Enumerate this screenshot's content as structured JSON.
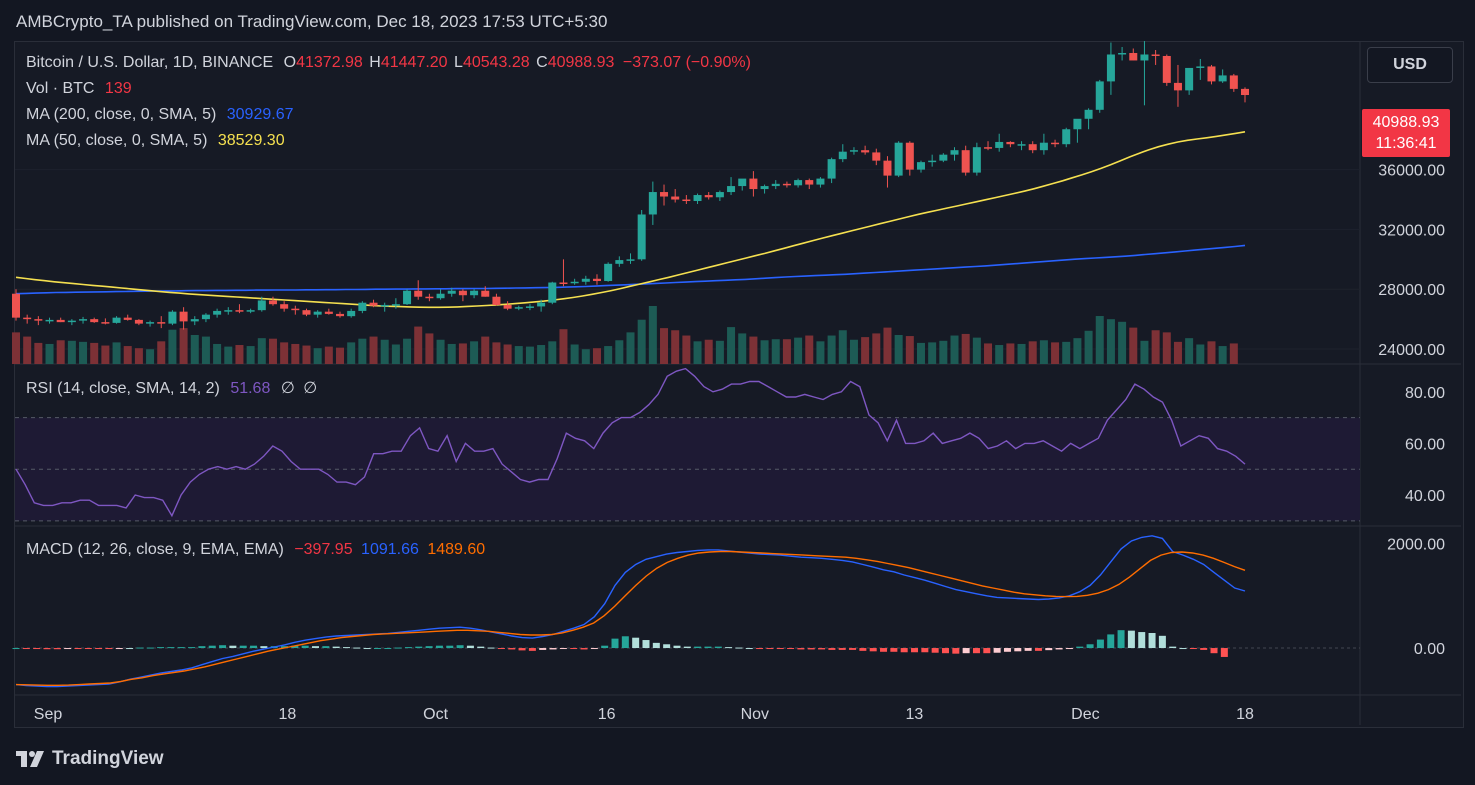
{
  "header": {
    "published_line": "AMBCrypto_TA published on TradingView.com, Dec 18, 2023 17:53 UTC+5:30"
  },
  "symbol": {
    "name": "Bitcoin / U.S. Dollar, 1D, BINANCE",
    "o_label": "O",
    "o_value": "41372.98",
    "h_label": "H",
    "h_value": "41447.20",
    "l_label": "L",
    "l_value": "40543.28",
    "c_label": "C",
    "c_value": "40988.93",
    "change": "−373.07 (−0.90%)"
  },
  "legend": {
    "vol_label": "Vol · BTC",
    "vol_value": "139",
    "ma200_label": "MA (200, close, 0, SMA, 5)",
    "ma200_value": "30929.67",
    "ma50_label": "MA (50, close, 0, SMA, 5)",
    "ma50_value": "38529.30",
    "rsi_label": "RSI (14, close, SMA, 14, 2)",
    "rsi_value": "51.68",
    "rsi_extra1": "∅",
    "rsi_extra2": "∅",
    "macd_label": "MACD (12, 26, close, 9, EMA, EMA)",
    "macd_hist": "−397.95",
    "macd_line": "1091.66",
    "macd_signal": "1489.60"
  },
  "currency_button": "USD",
  "price_badge": {
    "price": "40988.93",
    "countdown": "11:36:41"
  },
  "brand": "TradingView",
  "colors": {
    "up": "#26a69a",
    "down": "#ef5350",
    "ma200": "#2962ff",
    "ma50": "#f5e050",
    "rsi": "#7e57c2",
    "macd": "#2962ff",
    "signal": "#ff6d00",
    "bg": "#131722"
  },
  "chart_data": {
    "type": "candlestick",
    "x_ticks": [
      "Sep",
      "18",
      "Oct",
      "16",
      "Nov",
      "13",
      "Dec",
      "18"
    ],
    "price_axis": {
      "ticks": [
        24000,
        28000,
        32000,
        36000
      ],
      "range": [
        23000,
        44000
      ]
    },
    "rsi_axis": {
      "ticks": [
        40,
        60,
        80
      ],
      "bands": [
        30,
        50,
        70
      ],
      "range": [
        28,
        90
      ]
    },
    "macd_axis": {
      "ticks": [
        0,
        2000
      ],
      "range": [
        -900,
        2300
      ]
    },
    "candles": [
      [
        27700,
        28000,
        25900,
        26100
      ],
      [
        26100,
        26300,
        25700,
        26000
      ],
      [
        26000,
        26200,
        25600,
        25900
      ],
      [
        25900,
        26100,
        25700,
        25950
      ],
      [
        25950,
        26100,
        25800,
        25800
      ],
      [
        25800,
        26000,
        25600,
        25900
      ],
      [
        25900,
        26150,
        25700,
        26000
      ],
      [
        26000,
        26100,
        25750,
        25800
      ],
      [
        25800,
        26050,
        25650,
        25750
      ],
      [
        25750,
        26200,
        25700,
        26100
      ],
      [
        26100,
        26300,
        25900,
        25950
      ],
      [
        25950,
        26000,
        25600,
        25700
      ],
      [
        25700,
        25900,
        25500,
        25800
      ],
      [
        25800,
        26200,
        25400,
        25700
      ],
      [
        25700,
        26600,
        25600,
        26500
      ],
      [
        26500,
        26800,
        25300,
        25850
      ],
      [
        25850,
        26200,
        25600,
        26000
      ],
      [
        26000,
        26400,
        25800,
        26300
      ],
      [
        26300,
        26700,
        26100,
        26550
      ],
      [
        26550,
        26800,
        26300,
        26600
      ],
      [
        26600,
        27000,
        26400,
        26550
      ],
      [
        26550,
        26700,
        26400,
        26600
      ],
      [
        26600,
        27500,
        26500,
        27250
      ],
      [
        27250,
        27500,
        26900,
        27000
      ],
      [
        27000,
        27200,
        26500,
        26700
      ],
      [
        26700,
        26900,
        26300,
        26600
      ],
      [
        26600,
        26700,
        26200,
        26300
      ],
      [
        26300,
        26600,
        26100,
        26500
      ],
      [
        26500,
        26700,
        26300,
        26350
      ],
      [
        26350,
        26500,
        26100,
        26200
      ],
      [
        26200,
        26700,
        26100,
        26550
      ],
      [
        26550,
        27200,
        26400,
        27100
      ],
      [
        27100,
        27300,
        26800,
        26900
      ],
      [
        26900,
        27100,
        26500,
        26950
      ],
      [
        26950,
        27400,
        26700,
        27000
      ],
      [
        27000,
        28000,
        26950,
        27900
      ],
      [
        27900,
        28600,
        27300,
        27500
      ],
      [
        27500,
        27700,
        27200,
        27400
      ],
      [
        27400,
        28000,
        27300,
        27700
      ],
      [
        27700,
        28100,
        27500,
        27900
      ],
      [
        27900,
        28000,
        27200,
        27600
      ],
      [
        27600,
        28000,
        27400,
        27900
      ],
      [
        27900,
        28200,
        27500,
        27500
      ],
      [
        27500,
        27700,
        26900,
        26950
      ],
      [
        26950,
        27200,
        26600,
        26700
      ],
      [
        26700,
        26900,
        26600,
        26800
      ],
      [
        26800,
        27000,
        26600,
        26850
      ],
      [
        26850,
        27300,
        26500,
        27100
      ],
      [
        27100,
        28500,
        27000,
        28450
      ],
      [
        28450,
        30000,
        28200,
        28400
      ],
      [
        28400,
        28700,
        28300,
        28500
      ],
      [
        28500,
        28900,
        28300,
        28700
      ],
      [
        28700,
        29000,
        28300,
        28550
      ],
      [
        28550,
        29800,
        28500,
        29700
      ],
      [
        29700,
        30200,
        29500,
        29950
      ],
      [
        29950,
        30400,
        29700,
        30000
      ],
      [
        30000,
        33300,
        29900,
        33000
      ],
      [
        33000,
        35200,
        32300,
        34500
      ],
      [
        34500,
        35000,
        33600,
        34200
      ],
      [
        34200,
        34700,
        33800,
        34000
      ],
      [
        34000,
        34300,
        33700,
        33900
      ],
      [
        33900,
        34400,
        33700,
        34300
      ],
      [
        34300,
        34500,
        34000,
        34150
      ],
      [
        34150,
        34600,
        33900,
        34500
      ],
      [
        34500,
        35500,
        34300,
        34900
      ],
      [
        34900,
        35300,
        34600,
        35400
      ],
      [
        35400,
        35900,
        34200,
        34700
      ],
      [
        34700,
        35000,
        34400,
        34900
      ],
      [
        34900,
        35300,
        34700,
        35050
      ],
      [
        35050,
        35200,
        34800,
        34950
      ],
      [
        34950,
        35400,
        34800,
        35300
      ],
      [
        35300,
        35400,
        34700,
        35000
      ],
      [
        35000,
        35500,
        34800,
        35400
      ],
      [
        35400,
        36800,
        35100,
        36700
      ],
      [
        36700,
        37700,
        36500,
        37200
      ],
      [
        37200,
        37500,
        37000,
        37300
      ],
      [
        37300,
        37600,
        37000,
        37150
      ],
      [
        37150,
        37400,
        36300,
        36600
      ],
      [
        36600,
        36900,
        34800,
        35600
      ],
      [
        35600,
        37900,
        35500,
        37800
      ],
      [
        37800,
        37900,
        35600,
        36000
      ],
      [
        36000,
        36600,
        35800,
        36500
      ],
      [
        36500,
        37000,
        36200,
        36600
      ],
      [
        36600,
        37100,
        36500,
        37000
      ],
      [
        37000,
        37500,
        36600,
        37300
      ],
      [
        37300,
        37600,
        35600,
        35800
      ],
      [
        35800,
        37800,
        35600,
        37500
      ],
      [
        37500,
        37900,
        37300,
        37450
      ],
      [
        37450,
        38400,
        37200,
        37850
      ],
      [
        37850,
        37900,
        37500,
        37700
      ],
      [
        37700,
        37900,
        37300,
        37700
      ],
      [
        37700,
        37900,
        37100,
        37300
      ],
      [
        37300,
        38400,
        37000,
        37800
      ],
      [
        37800,
        38000,
        37500,
        37700
      ],
      [
        37700,
        38800,
        37500,
        38700
      ],
      [
        38700,
        39000,
        37800,
        39400
      ],
      [
        39400,
        40100,
        38700,
        40000
      ],
      [
        40000,
        42000,
        39800,
        41900
      ],
      [
        41900,
        44500,
        41000,
        43700
      ],
      [
        43700,
        44200,
        43300,
        43800
      ],
      [
        43800,
        44100,
        43300,
        43300
      ],
      [
        43300,
        44600,
        40300,
        43700
      ],
      [
        43700,
        44000,
        43000,
        43600
      ],
      [
        43600,
        43700,
        41600,
        41800
      ],
      [
        41800,
        43000,
        40200,
        41300
      ],
      [
        41300,
        42800,
        41000,
        42800
      ],
      [
        42800,
        43400,
        42000,
        42900
      ],
      [
        42900,
        43000,
        41700,
        41900
      ],
      [
        41900,
        42700,
        41800,
        42300
      ],
      [
        42300,
        42400,
        41200,
        41400
      ],
      [
        41400,
        41500,
        40500,
        40989
      ]
    ],
    "volumes": [
      60,
      52,
      40,
      38,
      45,
      44,
      42,
      40,
      35,
      41,
      34,
      30,
      28,
      43,
      65,
      68,
      55,
      52,
      38,
      33,
      36,
      34,
      49,
      48,
      41,
      38,
      35,
      30,
      33,
      31,
      41,
      48,
      52,
      46,
      37,
      48,
      71,
      58,
      46,
      38,
      39,
      43,
      52,
      41,
      37,
      34,
      33,
      36,
      43,
      66,
      37,
      28,
      30,
      34,
      45,
      60,
      84,
      110,
      68,
      64,
      54,
      43,
      46,
      44,
      70,
      58,
      52,
      45,
      47,
      47,
      50,
      54,
      43,
      54,
      64,
      46,
      51,
      58,
      69,
      55,
      53,
      40,
      41,
      44,
      54,
      57,
      50,
      39,
      36,
      39,
      38,
      43,
      45,
      41,
      42,
      49,
      63,
      91,
      85,
      80,
      69,
      44,
      64,
      60,
      42,
      49,
      37,
      43,
      34,
      39
    ],
    "ma200": [
      27700,
      27720,
      27740,
      27760,
      27780,
      27790,
      27800,
      27810,
      27820,
      27830,
      27840,
      27850,
      27860,
      27870,
      27880,
      27890,
      27890,
      27900,
      27910,
      27910,
      27920,
      27920,
      27930,
      27930,
      27940,
      27940,
      27950,
      27950,
      27950,
      27960,
      27960,
      27970,
      27970,
      27980,
      27980,
      27990,
      28000,
      28000,
      28010,
      28010,
      28020,
      28020,
      28030,
      28030,
      28040,
      28040,
      28050,
      28050,
      28060,
      28070,
      28080,
      28090,
      28100,
      28110,
      28120,
      28140,
      28160,
      28180,
      28210,
      28240,
      28270,
      28300,
      28330,
      28360,
      28390,
      28420,
      28450,
      28480,
      28510,
      28540,
      28570,
      28600,
      28630,
      28660,
      28700,
      28740,
      28780,
      28820,
      28850,
      28880,
      28910,
      28940,
      28970,
      29000,
      29040,
      29080,
      29120,
      29160,
      29200,
      29240,
      29280,
      29320,
      29360,
      29400,
      29440,
      29480,
      29520,
      29560,
      29610,
      29660,
      29710,
      29760,
      29810,
      29860,
      29910,
      29960,
      30010,
      30050,
      30090,
      30130,
      30170,
      30210,
      30260,
      30320,
      30380,
      30440,
      30500,
      30560,
      30620,
      30680,
      30740,
      30800,
      30860,
      30930
    ],
    "ma50": [
      28800,
      28720,
      28640,
      28570,
      28500,
      28440,
      28380,
      28320,
      28260,
      28200,
      28140,
      28080,
      28020,
      27960,
      27900,
      27840,
      27790,
      27740,
      27690,
      27640,
      27600,
      27560,
      27520,
      27480,
      27440,
      27400,
      27360,
      27320,
      27280,
      27240,
      27200,
      27160,
      27120,
      27080,
      27040,
      27000,
      26960,
      26920,
      26880,
      26860,
      26840,
      26820,
      26800,
      26790,
      26790,
      26800,
      26820,
      26850,
      26880,
      26910,
      26950,
      26990,
      27040,
      27090,
      27150,
      27210,
      27280,
      27360,
      27450,
      27550,
      27660,
      27780,
      27910,
      28050,
      28200,
      28350,
      28500,
      28650,
      28800,
      28960,
      29120,
      29280,
      29440,
      29600,
      29760,
      29920,
      30080,
      30240,
      30400,
      30570,
      30740,
      30910,
      31080,
      31250,
      31420,
      31580,
      31740,
      31900,
      32060,
      32220,
      32380,
      32540,
      32700,
      32860,
      33010,
      33150,
      33290,
      33430,
      33570,
      33710,
      33850,
      33990,
      34130,
      34270,
      34410,
      34560,
      34720,
      34890,
      35070,
      35250,
      35450,
      35650,
      35860,
      36080,
      36320,
      36580,
      36850,
      37100,
      37330,
      37530,
      37700,
      37850,
      37960,
      38050,
      38130,
      38220,
      38320,
      38420,
      38530
    ],
    "rsi": [
      50,
      44,
      37,
      36,
      36,
      37,
      37,
      38,
      38,
      36,
      36,
      36,
      35,
      40,
      39,
      39,
      38,
      32,
      40,
      45,
      48,
      50,
      51,
      50,
      51,
      50,
      52,
      55,
      59,
      57,
      53,
      50,
      50,
      50,
      48,
      45,
      45,
      44,
      47,
      56,
      56,
      57,
      57,
      63,
      66,
      58,
      57,
      63,
      53,
      60,
      57,
      57,
      58,
      52,
      49,
      46,
      45,
      46,
      46,
      54,
      64,
      62,
      61,
      58,
      64,
      68,
      70,
      70,
      72,
      75,
      79,
      86,
      88,
      89,
      86,
      82,
      80,
      81,
      83,
      83,
      84,
      84,
      82,
      80,
      78,
      78,
      79,
      78,
      77,
      79,
      80,
      84,
      82,
      71,
      68,
      61,
      69,
      60,
      60,
      61,
      64,
      60,
      61,
      62,
      64,
      62,
      58,
      59,
      61,
      58,
      60,
      60,
      61,
      59,
      57,
      60,
      58,
      60,
      62,
      69,
      73,
      77,
      83,
      81,
      78,
      76,
      69,
      59,
      61,
      63,
      62,
      58,
      57,
      55,
      52
    ],
    "macd_line": [
      -700,
      -720,
      -730,
      -740,
      -740,
      -730,
      -720,
      -710,
      -700,
      -690,
      -650,
      -600,
      -560,
      -520,
      -480,
      -450,
      -420,
      -380,
      -320,
      -260,
      -200,
      -160,
      -110,
      -60,
      -20,
      20,
      60,
      110,
      150,
      180,
      210,
      230,
      240,
      250,
      260,
      270,
      280,
      300,
      320,
      340,
      360,
      380,
      390,
      400,
      380,
      350,
      310,
      270,
      230,
      200,
      190,
      220,
      260,
      320,
      380,
      450,
      600,
      850,
      1200,
      1450,
      1600,
      1700,
      1750,
      1800,
      1830,
      1850,
      1870,
      1880,
      1880,
      1860,
      1840,
      1820,
      1800,
      1790,
      1780,
      1760,
      1740,
      1730,
      1720,
      1700,
      1680,
      1650,
      1600,
      1550,
      1500,
      1460,
      1400,
      1350,
      1300,
      1240,
      1180,
      1120,
      1080,
      1040,
      1000,
      970,
      960,
      950,
      940,
      930,
      940,
      960,
      1000,
      1080,
      1200,
      1400,
      1650,
      1900,
      2050,
      2120,
      2150,
      2100,
      1850,
      1780,
      1700,
      1600,
      1450,
      1300,
      1150,
      1092
    ],
    "macd_signal": [
      -700,
      -705,
      -710,
      -715,
      -715,
      -710,
      -700,
      -690,
      -680,
      -670,
      -640,
      -600,
      -570,
      -530,
      -500,
      -470,
      -440,
      -400,
      -360,
      -310,
      -260,
      -210,
      -160,
      -110,
      -60,
      -20,
      20,
      60,
      100,
      140,
      170,
      200,
      220,
      240,
      260,
      270,
      280,
      290,
      300,
      310,
      320,
      330,
      340,
      340,
      330,
      320,
      300,
      280,
      260,
      250,
      250,
      260,
      290,
      340,
      400,
      480,
      620,
      800,
      1000,
      1200,
      1380,
      1530,
      1640,
      1720,
      1780,
      1820,
      1840,
      1850,
      1850,
      1840,
      1830,
      1820,
      1810,
      1800,
      1790,
      1780,
      1770,
      1760,
      1750,
      1740,
      1720,
      1690,
      1660,
      1620,
      1580,
      1540,
      1490,
      1440,
      1390,
      1340,
      1290,
      1240,
      1190,
      1150,
      1110,
      1070,
      1040,
      1020,
      1000,
      990,
      985,
      990,
      1010,
      1050,
      1120,
      1220,
      1360,
      1520,
      1680,
      1780,
      1830,
      1840,
      1820,
      1780,
      1720,
      1640,
      1560,
      1490
    ]
  }
}
